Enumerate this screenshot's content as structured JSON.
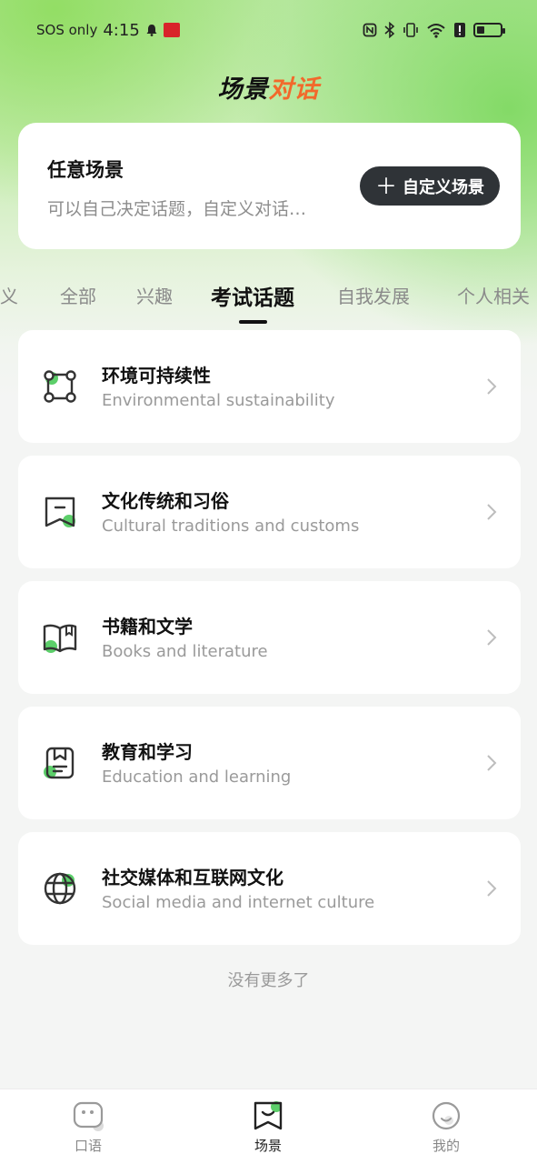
{
  "status_bar": {
    "carrier": "SOS only",
    "time": "4:15"
  },
  "app": {
    "logo_part1": "场景",
    "logo_part2": "对话"
  },
  "scene_card": {
    "title": "任意场景",
    "description": "可以自己决定话题，自定义对话…",
    "button_label": "自定义场景"
  },
  "tabs": [
    {
      "label": "义"
    },
    {
      "label": "全部"
    },
    {
      "label": "兴趣"
    },
    {
      "label": "考试话题",
      "active": true
    },
    {
      "label": "自我发展"
    },
    {
      "label": "个人相关"
    }
  ],
  "topics": [
    {
      "title": "环境可持续性",
      "subtitle": "Environmental sustainability",
      "icon": "nodes-icon"
    },
    {
      "title": "文化传统和习俗",
      "subtitle": "Cultural traditions and customs",
      "icon": "banner-icon"
    },
    {
      "title": "书籍和文学",
      "subtitle": "Books and literature",
      "icon": "book-icon"
    },
    {
      "title": "教育和学习",
      "subtitle": "Education and learning",
      "icon": "bookmark-doc-icon"
    },
    {
      "title": "社交媒体和互联网文化",
      "subtitle": "Social media and internet culture",
      "icon": "globe-icon"
    }
  ],
  "list_end_text": "没有更多了",
  "bottom_nav": [
    {
      "label": "口语",
      "icon": "chat-face-icon"
    },
    {
      "label": "场景",
      "icon": "scene-icon",
      "active": true
    },
    {
      "label": "我的",
      "icon": "profile-icon"
    }
  ],
  "colors": {
    "accent_green": "#5ccf6a",
    "accent_orange": "#f2692b",
    "button_dark": "#2f3337"
  }
}
